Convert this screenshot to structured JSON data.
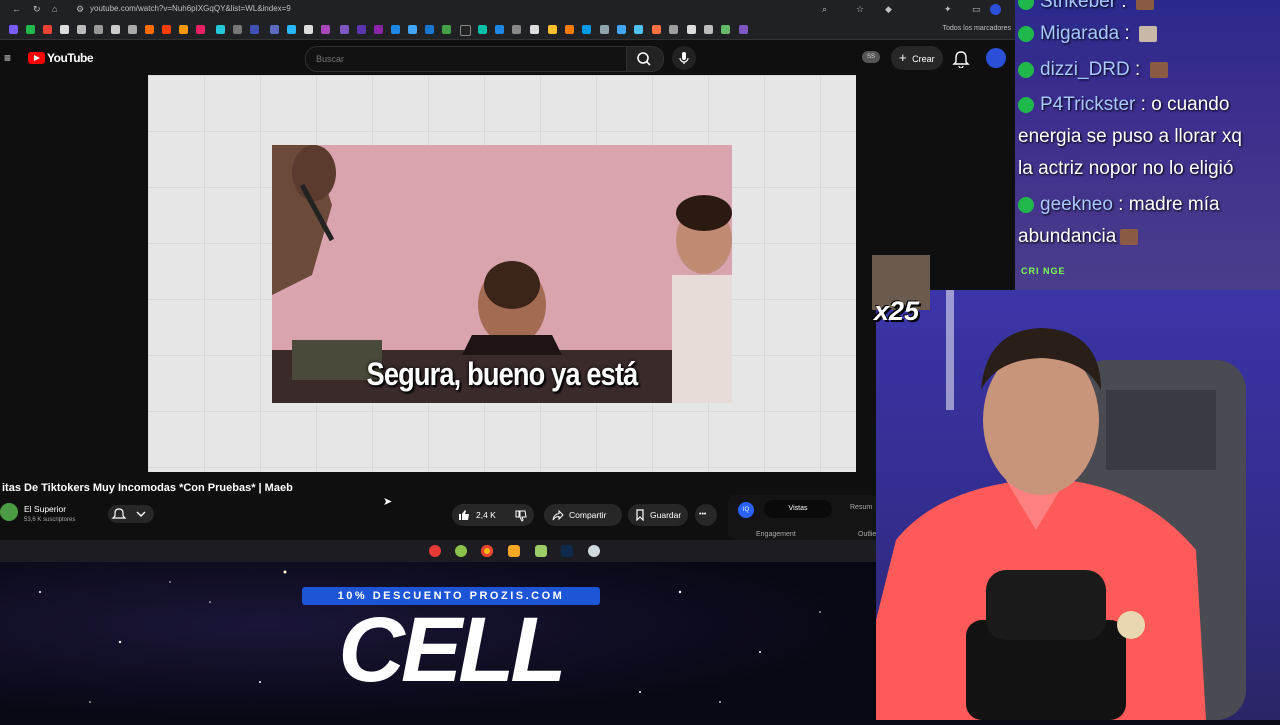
{
  "browser": {
    "url": "youtube.com/watch?v=Nuh6pIXGqQY&list=WL&index=9",
    "bookmarks_all": "Todos los marcadores"
  },
  "youtube": {
    "brand": "YouTube",
    "search_placeholder": "Buscar",
    "ss_badge": "SS",
    "create_label": "Crear"
  },
  "video": {
    "subtitle": "Segura, bueno ya está",
    "title": "itas De Tiktokers Muy Incomodas *Con Pruebas* | Maeb",
    "channel": "El Superior",
    "subscribers": "53,6 K suscriptores",
    "likes": "2,4 K",
    "share_label": "Compartir",
    "save_label": "Guardar",
    "more_label": "•••"
  },
  "extension": {
    "logo": "IQ",
    "tab_views": "Vistas",
    "tab_summary": "Resum",
    "engagement_label": "Engagement",
    "outlier_label": "Outlie"
  },
  "overlay": {
    "promo": "10% DESCUENTO PROZIS.COM",
    "logo": "CELL",
    "emote_count": "x25",
    "cringe_text": "CRI  NGE"
  },
  "chat": [
    {
      "user": "Strikeber",
      "sep": " : ",
      "message": ""
    },
    {
      "user": "Migarada",
      "sep": " : ",
      "message": ""
    },
    {
      "user": "dizzi_DRD",
      "sep": " : ",
      "message": ""
    },
    {
      "user": "P4Trickster",
      "sep": " : ",
      "message": "o cuando"
    },
    {
      "user": "",
      "sep": "",
      "message": "energia se puso a llorar xq"
    },
    {
      "user": "",
      "sep": "",
      "message": "la actriz nopor no lo eligió"
    },
    {
      "user": "geekneo",
      "sep": " : ",
      "message": "madre mía"
    },
    {
      "user": "",
      "sep": "",
      "message": "abundancia"
    }
  ],
  "colors": {
    "youtube_red": "#ff0000",
    "chat_badge": "#1fb84a",
    "promo_blue": "#1c55d6"
  },
  "icons": [
    "menu-icon",
    "search-icon",
    "mic-icon",
    "plus-icon",
    "bell-icon",
    "thumbs-up-icon",
    "thumbs-down-icon",
    "share-icon",
    "bookmark-icon",
    "chevron-down-icon"
  ]
}
